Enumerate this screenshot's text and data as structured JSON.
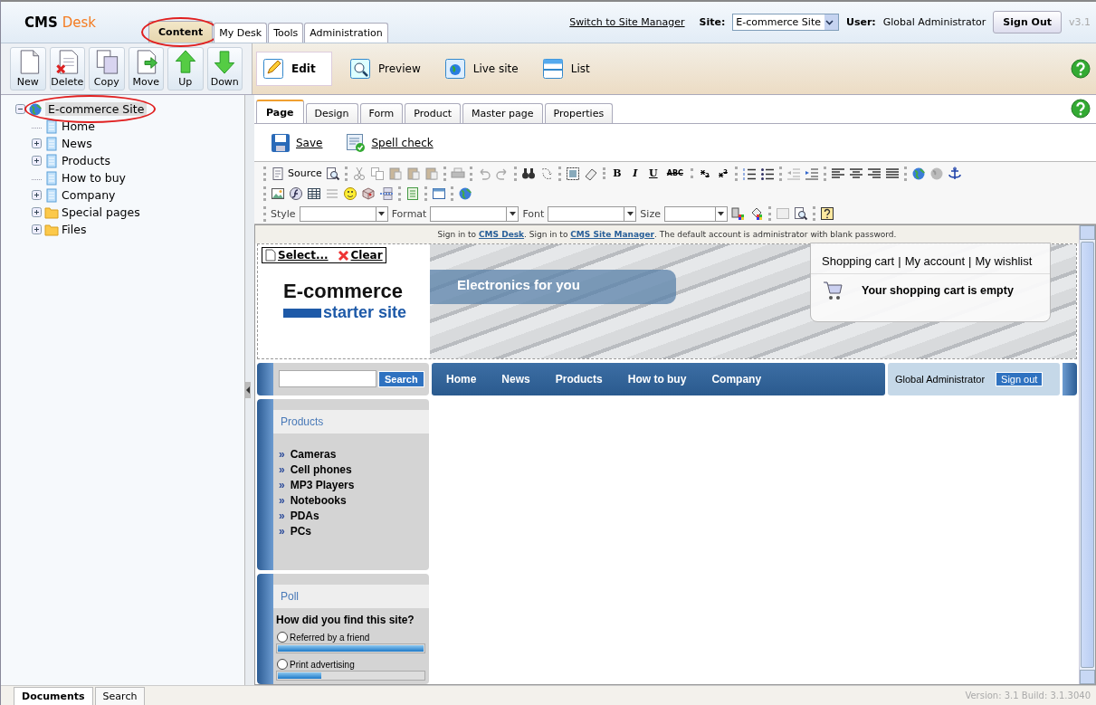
{
  "app": {
    "logo_primary": "CMS",
    "logo_secondary": "Desk",
    "version": "v3.1"
  },
  "main_tabs": [
    {
      "label": "Content",
      "selected": true,
      "circled": true
    },
    {
      "label": "My Desk",
      "selected": false,
      "circled": false
    },
    {
      "label": "Tools",
      "selected": false,
      "circled": false
    },
    {
      "label": "Administration",
      "selected": false,
      "circled": false
    }
  ],
  "header": {
    "switch_link": "Switch to Site Manager",
    "site_label": "Site:",
    "site_value": "E-commerce Site",
    "user_label": "User:",
    "user_name": "Global Administrator",
    "sign_out": "Sign Out"
  },
  "actions": [
    "New",
    "Delete",
    "Copy",
    "Move",
    "Up",
    "Down"
  ],
  "views": [
    {
      "label": "Edit",
      "selected": true
    },
    {
      "label": "Preview",
      "selected": false
    },
    {
      "label": "Live site",
      "selected": false
    },
    {
      "label": "List",
      "selected": false
    }
  ],
  "tree": {
    "label": "E-commerce Site",
    "kind": "site",
    "expanded": true,
    "selected": true,
    "circled": true,
    "children": [
      {
        "label": "Home",
        "kind": "page",
        "expandable": false,
        "selected": false
      },
      {
        "label": "News",
        "kind": "page",
        "expandable": true,
        "selected": false
      },
      {
        "label": "Products",
        "kind": "page",
        "expandable": true,
        "selected": false
      },
      {
        "label": "How to buy",
        "kind": "page",
        "expandable": false,
        "selected": false
      },
      {
        "label": "Company",
        "kind": "page",
        "expandable": true,
        "selected": false
      },
      {
        "label": "Special pages",
        "kind": "folder",
        "expandable": true,
        "selected": false
      },
      {
        "label": "Files",
        "kind": "folder",
        "expandable": true,
        "selected": false
      }
    ]
  },
  "page_tabs": [
    {
      "label": "Page",
      "selected": true
    },
    {
      "label": "Design",
      "selected": false
    },
    {
      "label": "Form",
      "selected": false
    },
    {
      "label": "Product",
      "selected": false
    },
    {
      "label": "Master page",
      "selected": false
    },
    {
      "label": "Properties",
      "selected": false
    }
  ],
  "page_actions": [
    "Save",
    "Spell check"
  ],
  "editor": {
    "source": "Source",
    "format_buttons": [
      "B",
      "I",
      "U",
      "ABC",
      "x$_{2}$",
      "x$^{2}$"
    ],
    "selects": [
      "Style",
      "Format",
      "Font",
      "Size"
    ]
  },
  "site": {
    "notice": [
      {
        "text": "Sign in to ",
        "link": false
      },
      {
        "text": "CMS Desk",
        "link": true
      },
      {
        "text": ". Sign in to ",
        "link": false
      },
      {
        "text": "CMS Site Manager",
        "link": true
      },
      {
        "text": ". The default account is administrator with blank password.",
        "link": false
      }
    ],
    "select_button": "Select...",
    "clear_button": "Clear",
    "logo_line1": "E-commerce",
    "logo_line2": "starter site",
    "banner_text": "Electronics for you",
    "cart_links": [
      "Shopping cart",
      "My account",
      "My wishlist"
    ],
    "cart_separator": "|",
    "cart_status": "Your shopping cart is empty",
    "search_button": "Search",
    "menu": [
      "Home",
      "News",
      "Products",
      "How to buy",
      "Company"
    ],
    "user": "Global Administrator",
    "sign_out": "Sign out",
    "products": {
      "title": "Products",
      "bullet": "»",
      "items": [
        "Cameras",
        "Cell phones",
        "MP3 Players",
        "Notebooks",
        "PDAs",
        "PCs"
      ]
    },
    "poll": {
      "title": "Poll",
      "question": "How did you find this site?",
      "options": [
        {
          "label": "Referred by a friend",
          "selected": false,
          "level": 1.0
        },
        {
          "label": "Print advertising",
          "selected": false,
          "level": 0.3
        }
      ]
    }
  },
  "bottom_tabs": [
    {
      "label": "Documents",
      "selected": true
    },
    {
      "label": "Search",
      "selected": false
    }
  ],
  "build": "Version: 3.1 Build: 3.1.3040"
}
